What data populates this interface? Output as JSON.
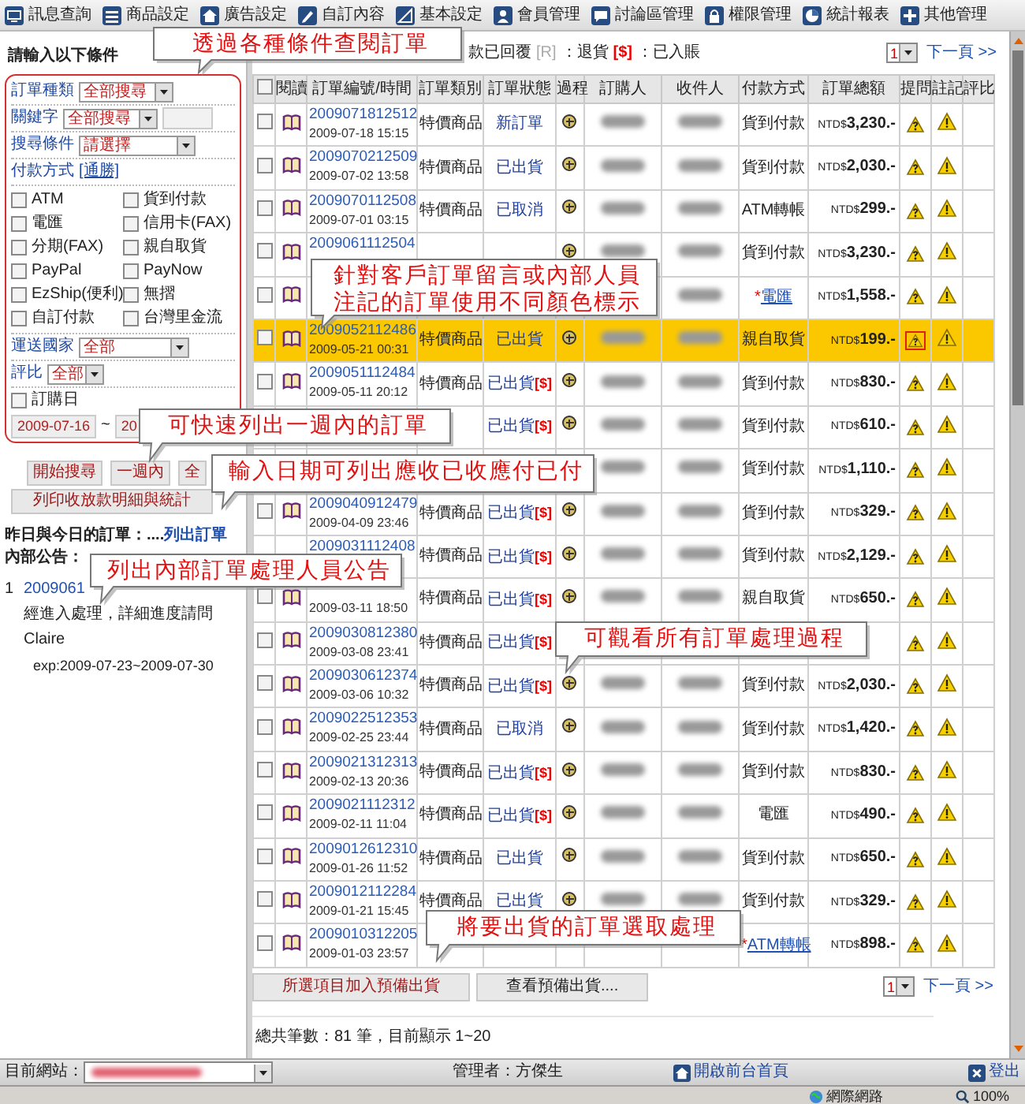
{
  "nav": [
    {
      "label": "訊息查詢"
    },
    {
      "label": "商品設定"
    },
    {
      "label": "廣告設定"
    },
    {
      "label": "自訂內容"
    },
    {
      "label": "基本設定"
    },
    {
      "label": "會員管理"
    },
    {
      "label": "討論區管理"
    },
    {
      "label": "權限管理"
    },
    {
      "label": "統計報表"
    },
    {
      "label": "其他管理"
    }
  ],
  "filter": {
    "title": "請輸入以下條件",
    "order_type": {
      "label": "訂單種類",
      "value": "全部搜尋"
    },
    "keyword": {
      "label": "關鍵字",
      "value": "全部搜尋"
    },
    "condition": {
      "label": "搜尋條件",
      "value": "請選擇"
    },
    "payment": {
      "label": "付款方式",
      "action": "[通勝]",
      "options": [
        {
          "label": "ATM",
          "checked": false
        },
        {
          "label": "貨到付款",
          "checked": false
        },
        {
          "label": "電匯",
          "checked": false
        },
        {
          "label": "信用卡(FAX)",
          "checked": false
        },
        {
          "label": "分期(FAX)",
          "checked": false
        },
        {
          "label": "親自取貨",
          "checked": false
        },
        {
          "label": "PayPal",
          "checked": false
        },
        {
          "label": "PayNow",
          "checked": false
        },
        {
          "label": "EzShip(便利)",
          "checked": false
        },
        {
          "label": "無摺",
          "checked": false
        },
        {
          "label": "自訂付款",
          "checked": false
        },
        {
          "label": "台灣里金流",
          "checked": false
        }
      ]
    },
    "country": {
      "label": "運送國家",
      "value": "全部"
    },
    "rating": {
      "label": "評比",
      "value": "全部"
    },
    "order_date": {
      "label": "訂購日",
      "checked": false,
      "from": "2009-07-16",
      "separator": "~",
      "to": "20"
    },
    "buttons": [
      "開始搜尋",
      "一週內",
      "全"
    ],
    "print_button": "列印收放款明細與統計"
  },
  "orders_today": {
    "label": "昨日與今日的訂單：....",
    "link": "列出訂單"
  },
  "notice": {
    "title": "內部公告：",
    "items": [
      {
        "index": "1",
        "link": "2009061",
        "text": "經進入處理，詳細進度請問",
        "author": "Claire",
        "period": "exp:2009-07-23~2009-07-30"
      }
    ]
  },
  "legend": {
    "replied": "款已回覆",
    "return_code": "[R]",
    "return_label": "：退貨",
    "paid_code": "[$]",
    "paid_label": "：已入賬"
  },
  "pager_top": {
    "page": "1",
    "next": "下一頁 >>"
  },
  "table": {
    "select_all_checked": false,
    "columns": [
      "閱讀",
      "訂單編號/時間",
      "訂單類別",
      "訂單狀態",
      "過程",
      "訂購人",
      "收件人",
      "付款方式",
      "訂單總額",
      "提問",
      "註記",
      "評比"
    ],
    "rows": [
      {
        "checked": false,
        "id": "2009071812512",
        "date": "2009-07-18 15:15",
        "category": "特價商品",
        "status": "新訂單",
        "payment": "貨到付款",
        "payment_link": false,
        "currency": "NTD$",
        "amount": "3,230.-",
        "highlighted": false,
        "flagged": false
      },
      {
        "checked": false,
        "id": "2009070212509",
        "date": "2009-07-02 13:58",
        "category": "特價商品",
        "status": "已出貨",
        "payment": "貨到付款",
        "payment_link": false,
        "currency": "NTD$",
        "amount": "2,030.-",
        "highlighted": false,
        "flagged": false
      },
      {
        "checked": false,
        "id": "2009070112508",
        "date": "2009-07-01 03:15",
        "category": "特價商品",
        "status": "已取消",
        "payment": "ATM轉帳",
        "payment_link": false,
        "currency": "NTD$",
        "amount": "299.-",
        "highlighted": false,
        "flagged": false
      },
      {
        "checked": false,
        "id": "2009061112504",
        "payment": "貨到付款",
        "payment_link": false,
        "currency": "NTD$",
        "amount": "3,230.-",
        "highlighted": false,
        "flagged": false
      },
      {
        "checked": false,
        "payment_mark": "*",
        "payment": "電匯",
        "payment_link": true,
        "currency": "NTD$",
        "amount": "1,558.-",
        "highlighted": false,
        "flagged": false
      },
      {
        "checked": false,
        "id": "2009052112486",
        "date": "2009-05-21 00:31",
        "category": "特價商品",
        "status": "已出貨",
        "payment": "親自取貨",
        "payment_link": false,
        "currency": "NTD$",
        "amount": "199.-",
        "highlighted": true,
        "flagged": true
      },
      {
        "checked": false,
        "id": "2009051112484",
        "date": "2009-05-11 20:12",
        "category": "特價商品",
        "status": "已出貨",
        "paid": "[$]",
        "payment": "貨到付款",
        "payment_link": false,
        "currency": "NTD$",
        "amount": "830.-",
        "highlighted": false,
        "flagged": false
      },
      {
        "status": "已出貨",
        "paid": "[$]",
        "payment": "貨到付款",
        "payment_link": false,
        "currency": "NTD$",
        "amount": "610.-",
        "highlighted": false,
        "flagged": false
      },
      {
        "payment": "貨到付款",
        "payment_link": false,
        "currency": "NTD$",
        "amount": "1,110.-",
        "highlighted": false,
        "flagged": false
      },
      {
        "checked": false,
        "id": "2009040912479",
        "date": "2009-04-09 23:46",
        "category": "特價商品",
        "status": "已出貨",
        "paid": "[$]",
        "payment": "貨到付款",
        "payment_link": false,
        "currency": "NTD$",
        "amount": "329.-",
        "highlighted": false,
        "flagged": false
      },
      {
        "id": "2009031112408",
        "category": "特價商品",
        "status": "已出貨",
        "paid": "[$]",
        "payment": "貨到付款",
        "payment_link": false,
        "currency": "NTD$",
        "amount": "2,129.-",
        "highlighted": false,
        "flagged": false
      },
      {
        "checked": false,
        "date": "2009-03-11 18:50",
        "category": "特價商品",
        "status": "已出貨",
        "paid": "[$]",
        "payment": "親自取貨",
        "payment_link": false,
        "currency": "NTD$",
        "amount": "650.-",
        "highlighted": false,
        "flagged": false
      },
      {
        "checked": false,
        "id": "2009030812380",
        "date": "2009-03-08 23:41",
        "category": "特價商品",
        "status": "已出貨",
        "paid": "[$]",
        "highlighted": false,
        "flagged": false
      },
      {
        "checked": false,
        "id": "2009030612374",
        "date": "2009-03-06 10:32",
        "category": "特價商品",
        "status": "已出貨",
        "paid": "[$]",
        "payment": "貨到付款",
        "payment_link": false,
        "currency": "NTD$",
        "amount": "2,030.-",
        "highlighted": false,
        "flagged": false
      },
      {
        "checked": false,
        "id": "2009022512353",
        "date": "2009-02-25 23:44",
        "category": "特價商品",
        "status": "已取消",
        "payment": "貨到付款",
        "payment_link": false,
        "currency": "NTD$",
        "amount": "1,420.-",
        "highlighted": false,
        "flagged": false
      },
      {
        "checked": false,
        "id": "2009021312313",
        "date": "2009-02-13 20:36",
        "category": "特價商品",
        "status": "已出貨",
        "paid": "[$]",
        "payment": "貨到付款",
        "payment_link": false,
        "currency": "NTD$",
        "amount": "830.-",
        "highlighted": false,
        "flagged": false
      },
      {
        "checked": false,
        "id": "2009021112312",
        "date": "2009-02-11 11:04",
        "category": "特價商品",
        "status": "已出貨",
        "paid": "[$]",
        "payment": "電匯",
        "payment_link": false,
        "currency": "NTD$",
        "amount": "490.-",
        "highlighted": false,
        "flagged": false
      },
      {
        "checked": false,
        "id": "2009012612310",
        "date": "2009-01-26 11:52",
        "category": "特價商品",
        "status": "已出貨",
        "payment": "貨到付款",
        "payment_link": false,
        "currency": "NTD$",
        "amount": "650.-",
        "highlighted": false,
        "flagged": false
      },
      {
        "checked": false,
        "id": "2009012112284",
        "date": "2009-01-21 15:45",
        "category": "特價商品",
        "status": "已出貨",
        "payment": "貨到付款",
        "payment_link": false,
        "currency": "NTD$",
        "amount": "329.-",
        "highlighted": false,
        "flagged": false
      },
      {
        "checked": false,
        "id": "2009010312205",
        "date": "2009-01-03 23:57",
        "payment_mark": "*",
        "payment": "ATM轉帳",
        "payment_link": true,
        "currency": "NTD$",
        "amount": "898.-",
        "highlighted": false,
        "flagged": false
      }
    ]
  },
  "footer": {
    "buttons": [
      "所選項目加入預備出貨",
      "查看預備出貨...."
    ],
    "pager": {
      "page": "1",
      "next": "下一頁 >>"
    },
    "total": "總共筆數：81 筆，目前顯示 1~20"
  },
  "status_bar": {
    "site_label": "目前網站：",
    "admin": "管理者：方傑生",
    "home_link": "開啟前台首頁",
    "logout": "登出"
  },
  "browser_status": {
    "zone": "網際網路",
    "zoom": "100%"
  },
  "callouts": [
    {
      "lines": [
        "透過各種條件查閱訂單"
      ]
    },
    {
      "lines": [
        "針對客戶訂單留言或內部人員",
        "注記的訂單使用不同顏色標示"
      ]
    },
    {
      "lines": [
        "可快速列出一週內的訂單"
      ]
    },
    {
      "lines": [
        "輸入日期可列出應收已收應付已付"
      ]
    },
    {
      "lines": [
        "列出內部訂單處理人員公告"
      ]
    },
    {
      "lines": [
        "可觀看所有訂單處理過程"
      ]
    },
    {
      "lines": [
        "將要出貨的訂單選取處理"
      ]
    }
  ]
}
